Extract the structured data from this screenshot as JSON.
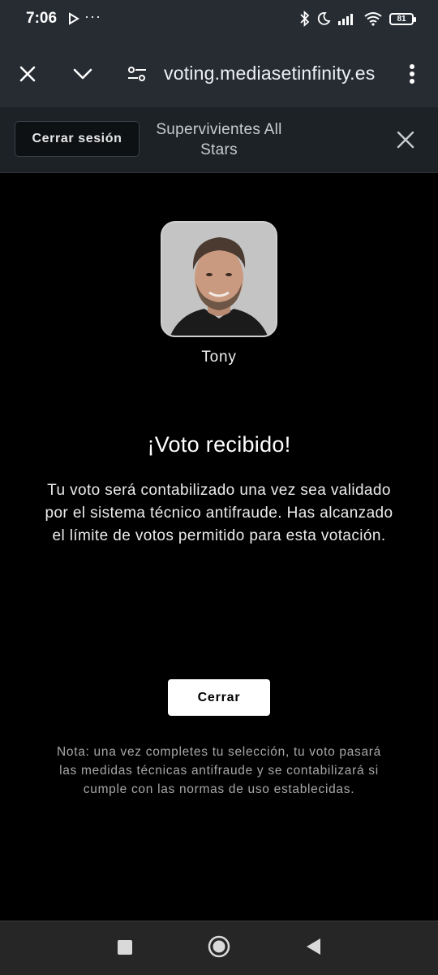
{
  "status_bar": {
    "time": "7:06",
    "more": "···",
    "battery": "81"
  },
  "browser": {
    "url": "voting.mediasetinfinity.es"
  },
  "header": {
    "logout_label": "Cerrar sesión",
    "show_title": "Supervivientes All Stars"
  },
  "content": {
    "contestant_name": "Tony",
    "title": "¡Voto recibido!",
    "message": "Tu voto será contabilizado una vez sea validado por el sistema técnico antifraude. Has alcanzado el límite de votos permitido para esta votación.",
    "close_label": "Cerrar",
    "note": "Nota: una vez completes tu selección, tu voto pasará las medidas técnicas antifraude y se contabilizará si cumple con las normas de uso establecidas."
  },
  "colors": {
    "status_bg": "#272c33",
    "header_bg": "#1d2227",
    "page_bg": "#000000",
    "button_bg": "#ffffff"
  }
}
